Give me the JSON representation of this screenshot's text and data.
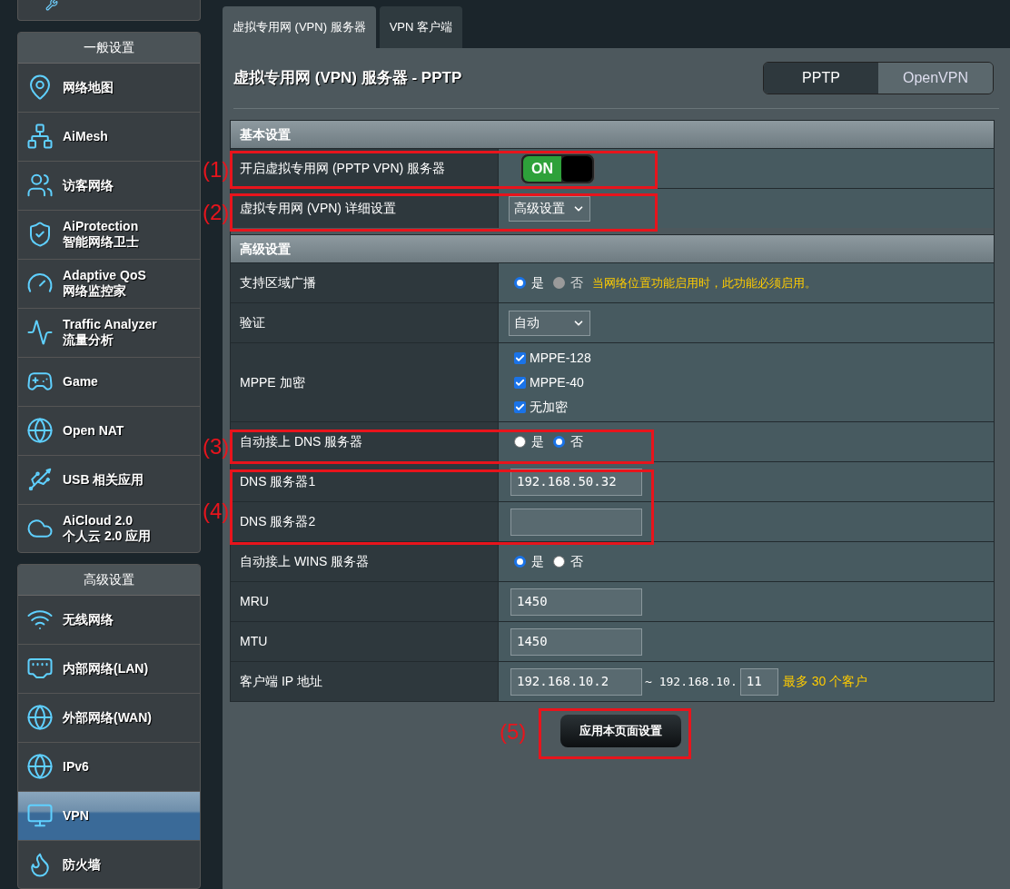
{
  "sidebar": {
    "sections": [
      {
        "title": "一般设置",
        "items": [
          {
            "label": "网络地图",
            "selected": false
          },
          {
            "label": "AiMesh",
            "selected": false
          },
          {
            "label": "访客网络",
            "selected": false
          },
          {
            "label": "AiProtection",
            "sublabel": "智能网络卫士",
            "selected": false
          },
          {
            "label": "Adaptive QoS",
            "sublabel": "网络监控家",
            "selected": false
          },
          {
            "label": "Traffic Analyzer",
            "sublabel": "流量分析",
            "selected": false
          },
          {
            "label": "Game",
            "selected": false
          },
          {
            "label": "Open NAT",
            "selected": false
          },
          {
            "label": "USB 相关应用",
            "selected": false
          },
          {
            "label": "AiCloud 2.0",
            "sublabel": "个人云 2.0 应用",
            "selected": false
          }
        ]
      },
      {
        "title": "高级设置",
        "items": [
          {
            "label": "无线网络",
            "selected": false
          },
          {
            "label": "内部网络(LAN)",
            "selected": false
          },
          {
            "label": "外部网络(WAN)",
            "selected": false
          },
          {
            "label": "IPv6",
            "selected": false
          },
          {
            "label": "VPN",
            "selected": true
          },
          {
            "label": "防火墙",
            "selected": false
          }
        ]
      }
    ]
  },
  "tabs": [
    {
      "label": "虚拟专用网 (VPN) 服务器",
      "selected": true
    },
    {
      "label": "VPN 客户端",
      "selected": false
    }
  ],
  "page_title": "虚拟专用网 (VPN) 服务器 - PPTP",
  "mode_switch": [
    {
      "label": "PPTP",
      "selected": true
    },
    {
      "label": "OpenVPN",
      "selected": false
    }
  ],
  "sections": [
    {
      "title": "基本设置",
      "rows": [
        {
          "kind": "toggle",
          "label": "开启虚拟专用网 (PPTP VPN) 服务器",
          "on": true,
          "text": "ON"
        },
        {
          "kind": "select",
          "label": "虚拟专用网 (VPN) 详细设置",
          "value": "高级设置"
        }
      ]
    },
    {
      "title": "高级设置",
      "rows": [
        {
          "kind": "radio",
          "label": "支持区域广播",
          "options": [
            {
              "label": "是",
              "selected": true,
              "disabled": false
            },
            {
              "label": "否",
              "selected": false,
              "disabled": true
            }
          ],
          "note": "当网络位置功能启用时，此功能必须启用。"
        },
        {
          "kind": "select",
          "label": "验证",
          "value": "自动"
        },
        {
          "kind": "checkboxes",
          "label": "MPPE 加密",
          "options": [
            {
              "label": "MPPE-128",
              "checked": true
            },
            {
              "label": "MPPE-40",
              "checked": true
            },
            {
              "label": "无加密",
              "checked": true
            }
          ]
        },
        {
          "kind": "radio",
          "label": "自动接上 DNS 服务器",
          "options": [
            {
              "label": "是",
              "selected": false,
              "disabled": false
            },
            {
              "label": "否",
              "selected": true,
              "disabled": false
            }
          ]
        },
        {
          "kind": "input",
          "label": "DNS 服务器1",
          "value": "192.168.50.32"
        },
        {
          "kind": "input",
          "label": "DNS 服务器2"
        },
        {
          "kind": "radio",
          "label": "自动接上 WINS 服务器",
          "options": [
            {
              "label": "是",
              "selected": true,
              "disabled": false
            },
            {
              "label": "否",
              "selected": false,
              "disabled": false
            }
          ]
        },
        {
          "kind": "input",
          "label": "MRU",
          "value": "1450"
        },
        {
          "kind": "input",
          "label": "MTU",
          "value": "1450"
        },
        {
          "kind": "range",
          "label": "客户端 IP 地址",
          "start": "192.168.10.2",
          "separator": "~ 192.168.10.",
          "end": "11",
          "note": "最多 30 个客户"
        }
      ]
    }
  ],
  "apply_button": "应用本页面设置",
  "annotations": [
    {
      "label": "(1)"
    },
    {
      "label": "(2)"
    },
    {
      "label": "(3)"
    },
    {
      "label": "(4)"
    },
    {
      "label": "(5)"
    }
  ]
}
